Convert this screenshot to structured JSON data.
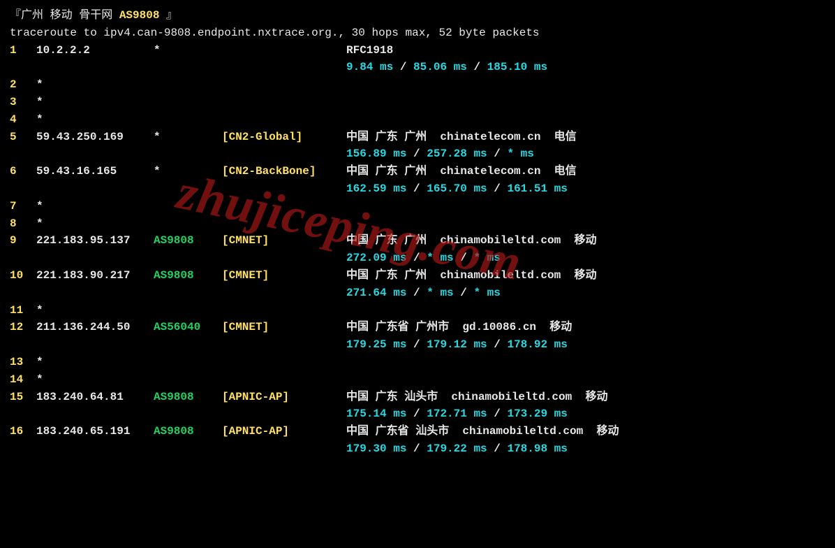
{
  "title": {
    "open": "『",
    "text": "广州 移动 骨干网 ",
    "as": "AS9808",
    "close": " 』"
  },
  "header": "traceroute to ipv4.can-9808.endpoint.nxtrace.org., 30 hops max, 52 byte packets",
  "watermark": "zhujiceping.com",
  "hops": [
    {
      "n": "1",
      "ip": "10.2.2.2",
      "asn": "*",
      "asn_star": true,
      "net": "",
      "loc": "RFC1918",
      "lat": [
        "9.84 ms",
        "85.06 ms",
        "185.10 ms"
      ]
    },
    {
      "n": "2",
      "ip": "*",
      "star": true
    },
    {
      "n": "3",
      "ip": "*",
      "star": true
    },
    {
      "n": "4",
      "ip": "*",
      "star": true
    },
    {
      "n": "5",
      "ip": "59.43.250.169",
      "asn": "*",
      "asn_star": true,
      "net": "[CN2-Global]",
      "loc": "中国 广东 广州  chinatelecom.cn  电信",
      "lat": [
        "156.89 ms",
        "257.28 ms",
        "* ms"
      ]
    },
    {
      "n": "6",
      "ip": "59.43.16.165",
      "asn": "*",
      "asn_star": true,
      "net": "[CN2-BackBone]",
      "loc": "中国 广东 广州  chinatelecom.cn  电信",
      "lat": [
        "162.59 ms",
        "165.70 ms",
        "161.51 ms"
      ]
    },
    {
      "n": "7",
      "ip": "*",
      "star": true
    },
    {
      "n": "8",
      "ip": "*",
      "star": true
    },
    {
      "n": "9",
      "ip": "221.183.95.137",
      "asn": "AS9808",
      "net": "[CMNET]",
      "loc": "中国 广东 广州  chinamobileltd.com  移动",
      "lat": [
        "272.09 ms",
        "* ms",
        "* ms"
      ]
    },
    {
      "n": "10",
      "ip": "221.183.90.217",
      "asn": "AS9808",
      "net": "[CMNET]",
      "loc": "中国 广东 广州  chinamobileltd.com  移动",
      "lat": [
        "271.64 ms",
        "* ms",
        "* ms"
      ]
    },
    {
      "n": "11",
      "ip": "*",
      "star": true
    },
    {
      "n": "12",
      "ip": "211.136.244.50",
      "asn": "AS56040",
      "net": "[CMNET]",
      "loc": "中国 广东省 广州市  gd.10086.cn  移动",
      "lat": [
        "179.25 ms",
        "179.12 ms",
        "178.92 ms"
      ]
    },
    {
      "n": "13",
      "ip": "*",
      "star": true
    },
    {
      "n": "14",
      "ip": "*",
      "star": true
    },
    {
      "n": "15",
      "ip": "183.240.64.81",
      "asn": "AS9808",
      "net": "[APNIC-AP]",
      "loc": "中国 广东 汕头市  chinamobileltd.com  移动",
      "lat": [
        "175.14 ms",
        "172.71 ms",
        "173.29 ms"
      ]
    },
    {
      "n": "16",
      "ip": "183.240.65.191",
      "asn": "AS9808",
      "net": "[APNIC-AP]",
      "loc": "中国 广东省 汕头市  chinamobileltd.com  移动",
      "lat": [
        "179.30 ms",
        "179.22 ms",
        "178.98 ms"
      ]
    }
  ]
}
